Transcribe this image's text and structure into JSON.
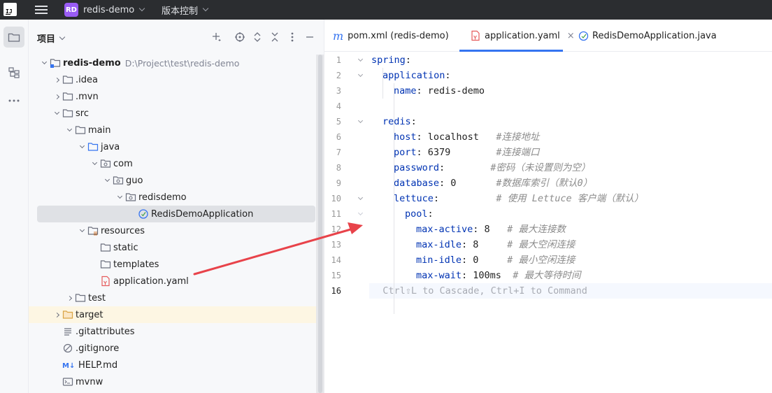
{
  "titlebar": {
    "logo": "jetbrains-logo",
    "project_badge": "RD",
    "project_name": "redis-demo",
    "vcs_label": "版本控制"
  },
  "project_panel": {
    "title": "项目",
    "tree": [
      {
        "label": "redis-demo",
        "path": "D:\\Project\\test\\redis-demo",
        "icon": "module-folder-icon",
        "depth": 0,
        "expanded": true
      },
      {
        "label": ".idea",
        "icon": "folder-icon",
        "depth": 1,
        "expanded": false
      },
      {
        "label": ".mvn",
        "icon": "folder-icon",
        "depth": 1,
        "expanded": false
      },
      {
        "label": "src",
        "icon": "folder-icon",
        "depth": 1,
        "expanded": true
      },
      {
        "label": "main",
        "icon": "folder-icon",
        "depth": 2,
        "expanded": true
      },
      {
        "label": "java",
        "icon": "source-folder-icon",
        "depth": 3,
        "expanded": true
      },
      {
        "label": "com",
        "icon": "package-icon",
        "depth": 4,
        "expanded": true
      },
      {
        "label": "guo",
        "icon": "package-icon",
        "depth": 5,
        "expanded": true
      },
      {
        "label": "redisdemo",
        "icon": "package-icon",
        "depth": 6,
        "expanded": true
      },
      {
        "label": "RedisDemoApplication",
        "icon": "spring-boot-class-icon",
        "depth": 7,
        "selected": true
      },
      {
        "label": "resources",
        "icon": "resources-folder-icon",
        "depth": 3,
        "expanded": true
      },
      {
        "label": "static",
        "icon": "folder-icon",
        "depth": 4
      },
      {
        "label": "templates",
        "icon": "folder-icon",
        "depth": 4
      },
      {
        "label": "application.yaml",
        "icon": "yaml-file-icon",
        "depth": 4
      },
      {
        "label": "test",
        "icon": "folder-icon",
        "depth": 2,
        "expanded": false
      },
      {
        "label": "target",
        "icon": "excluded-folder-icon",
        "depth": 1,
        "expanded": false,
        "highlight": true
      },
      {
        "label": ".gitattributes",
        "icon": "text-file-icon",
        "depth": 1
      },
      {
        "label": ".gitignore",
        "icon": "ignore-file-icon",
        "depth": 1
      },
      {
        "label": "HELP.md",
        "icon": "markdown-file-icon",
        "depth": 1
      },
      {
        "label": "mvnw",
        "icon": "shell-file-icon",
        "depth": 1
      }
    ]
  },
  "editor": {
    "tabs": [
      {
        "label": "pom.xml (redis-demo)",
        "icon": "maven-icon"
      },
      {
        "label": "application.yaml",
        "icon": "yaml-file-icon",
        "active": true,
        "close": "×"
      },
      {
        "label": "RedisDemoApplication.java",
        "icon": "spring-boot-class-icon"
      }
    ],
    "lines": [
      {
        "n": "1",
        "indent": 0,
        "key": "spring",
        "value": "",
        "comment": ""
      },
      {
        "n": "2",
        "indent": 1,
        "key": "application",
        "value": "",
        "comment": ""
      },
      {
        "n": "3",
        "indent": 2,
        "key": "name",
        "value": " redis-demo",
        "comment": ""
      },
      {
        "n": "4",
        "indent": 0,
        "key": "",
        "value": "",
        "comment": ""
      },
      {
        "n": "5",
        "indent": 1,
        "key": "redis",
        "value": "",
        "comment": ""
      },
      {
        "n": "6",
        "indent": 2,
        "key": "host",
        "value": " localhost   ",
        "comment": "#连接地址"
      },
      {
        "n": "7",
        "indent": 2,
        "key": "port",
        "value": " 6379        ",
        "comment": "#连接端口"
      },
      {
        "n": "8",
        "indent": 2,
        "key": "password",
        "value": "        ",
        "comment": "#密码（未设置则为空）"
      },
      {
        "n": "9",
        "indent": 2,
        "key": "database",
        "value": " 0       ",
        "comment": "#数据库索引（默认0）"
      },
      {
        "n": "10",
        "indent": 2,
        "key": "lettuce",
        "value": "          ",
        "comment": "# 使用 Lettuce 客户端（默认）"
      },
      {
        "n": "11",
        "indent": 3,
        "key": "pool",
        "value": "",
        "comment": ""
      },
      {
        "n": "12",
        "indent": 4,
        "key": "max-active",
        "value": " 8   ",
        "comment": "# 最大连接数"
      },
      {
        "n": "13",
        "indent": 4,
        "key": "max-idle",
        "value": " 8     ",
        "comment": "# 最大空闲连接"
      },
      {
        "n": "14",
        "indent": 4,
        "key": "min-idle",
        "value": " 0     ",
        "comment": "# 最小空闲连接"
      },
      {
        "n": "15",
        "indent": 4,
        "key": "max-wait",
        "value": " 100ms  ",
        "comment": "# 最大等待时间"
      },
      {
        "n": "16",
        "indent": 0,
        "key": "",
        "value": "",
        "comment": "",
        "hint": "  Ctrl⇧L to Cascade, Ctrl+I to Command",
        "current": true
      }
    ]
  },
  "annotation_color": "#e8434a",
  "colors": {
    "accent": "#3574f0",
    "key": "#0033b3",
    "comment": "#8c8c8c"
  }
}
